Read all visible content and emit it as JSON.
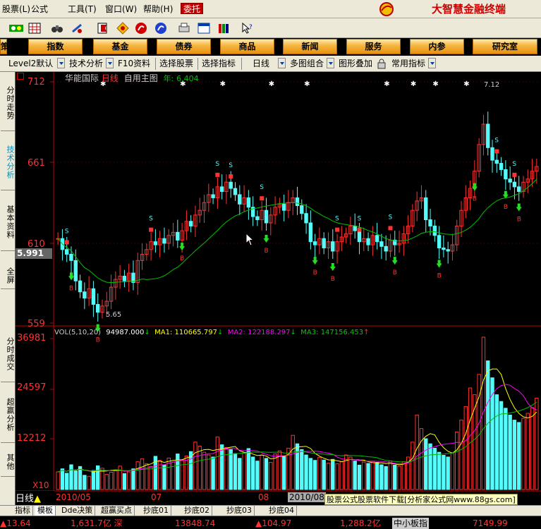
{
  "menu": {
    "items": [
      "股票(L)",
      "公式",
      "工具(T)",
      "窗口(W)",
      "帮助(H)",
      "委托"
    ]
  },
  "brand": {
    "name": "大智慧金融终端"
  },
  "nav": {
    "buttons": [
      "策",
      "指数",
      "基金",
      "债券",
      "商品",
      "新闻",
      "服务",
      "内参",
      "研究室"
    ]
  },
  "tabs": {
    "items": [
      "Level2默认",
      "技术分析",
      "F10资料",
      "选择股票",
      "选择指标",
      "日线",
      "多图组合",
      "图形叠加",
      "常用指标"
    ]
  },
  "sidebar": {
    "items": [
      "分时走势",
      "技术分析",
      "基本资料",
      "全屏",
      "分时成交",
      "超赢分析",
      "其他"
    ]
  },
  "chart": {
    "stock_name": "华能国际",
    "period": "日线",
    "template": "自用主图",
    "year_label": "年:",
    "year_value": "6.404",
    "price_ticks": [
      "712",
      "661",
      "610",
      "559"
    ],
    "current_price": "5.991",
    "high_label": "7.12",
    "low_label": "5.65",
    "vol_header": "VOL(5,10,20)",
    "vol_value": "94987.000",
    "ma1_label": "MA1:",
    "ma1_value": "110665.797",
    "ma2_label": "MA2:",
    "ma2_value": "122188.297",
    "ma3_label": "MA3:",
    "ma3_value": "147156.453",
    "vol_ticks": [
      "36981",
      "24597",
      "12212"
    ],
    "vol_unit": "X10",
    "date_labels": [
      "2010/05",
      "07",
      "08",
      "2010/08"
    ],
    "bottom_left": "日线"
  },
  "colors": {
    "up": "#ff3232",
    "down": "#54fcfc",
    "ma": "#00c000",
    "ma1": "#ffff00",
    "ma2": "#ff00ff",
    "axis": "#c00000"
  },
  "chart_data": {
    "type": "candlestick",
    "price_range": [
      5.59,
      7.12
    ],
    "volume_range": [
      0,
      45000
    ],
    "closes": [
      6.12,
      6.05,
      6.02,
      5.98,
      5.85,
      5.78,
      5.74,
      5.8,
      5.7,
      5.65,
      5.69,
      5.72,
      5.81,
      5.86,
      5.88,
      5.85,
      5.9,
      5.84,
      5.98,
      6.02,
      6.05,
      6.1,
      6.08,
      6.12,
      6.09,
      6.14,
      6.16,
      6.11,
      6.17,
      6.23,
      6.2,
      6.27,
      6.3,
      6.35,
      6.4,
      6.38,
      6.45,
      6.42,
      6.48,
      6.44,
      6.4,
      6.34,
      6.38,
      6.32,
      6.26,
      6.24,
      6.3,
      6.22,
      6.27,
      6.32,
      6.34,
      6.3,
      6.35,
      6.38,
      6.33,
      6.28,
      6.22,
      6.1,
      6.08,
      6.12,
      6.06,
      6.1,
      6.04,
      6.1,
      6.13,
      6.15,
      6.2,
      6.17,
      6.1,
      6.12,
      6.08,
      6.14,
      6.1,
      6.07,
      6.04,
      6.11,
      6.08,
      6.09,
      6.15,
      6.2,
      6.3,
      6.36,
      6.38,
      6.24,
      6.2,
      6.14,
      6.06,
      6.05,
      6.04,
      6.08,
      6.2,
      6.3,
      6.38,
      6.44,
      6.55,
      6.72,
      6.85,
      6.7,
      6.62,
      6.6,
      6.56,
      6.5,
      6.48,
      6.45,
      6.42,
      6.48,
      6.5,
      6.55,
      6.58
    ],
    "volume": [
      5200,
      6100,
      4800,
      7300,
      5500,
      6800,
      4200,
      3900,
      5600,
      7000,
      6300,
      4500,
      5100,
      5800,
      6900,
      4700,
      5200,
      6100,
      8200,
      9100,
      7600,
      6800,
      9800,
      8600,
      7200,
      9300,
      8100,
      10500,
      8800,
      9900,
      11200,
      14000,
      12800,
      11000,
      10200,
      9600,
      15500,
      13200,
      12400,
      11800,
      10600,
      9200,
      10800,
      12100,
      9600,
      8400,
      10100,
      9200,
      8000,
      10500,
      11400,
      9800,
      12200,
      16000,
      13500,
      11800,
      10200,
      9200,
      8600,
      9500,
      8700,
      7800,
      8900,
      7600,
      8200,
      10200,
      9600,
      8400,
      7200,
      8100,
      7700,
      8300,
      8000,
      7300,
      6800,
      8400,
      7200,
      6900,
      8200,
      9600,
      14000,
      22000,
      18000,
      15000,
      13500,
      12200,
      11000,
      10100,
      9600,
      10800,
      17000,
      20500,
      24500,
      30000,
      28000,
      34000,
      45000,
      38000,
      33000,
      28000,
      26000,
      24000,
      22000,
      20500,
      19800,
      21000,
      22500,
      24200,
      27000
    ]
  }
}
